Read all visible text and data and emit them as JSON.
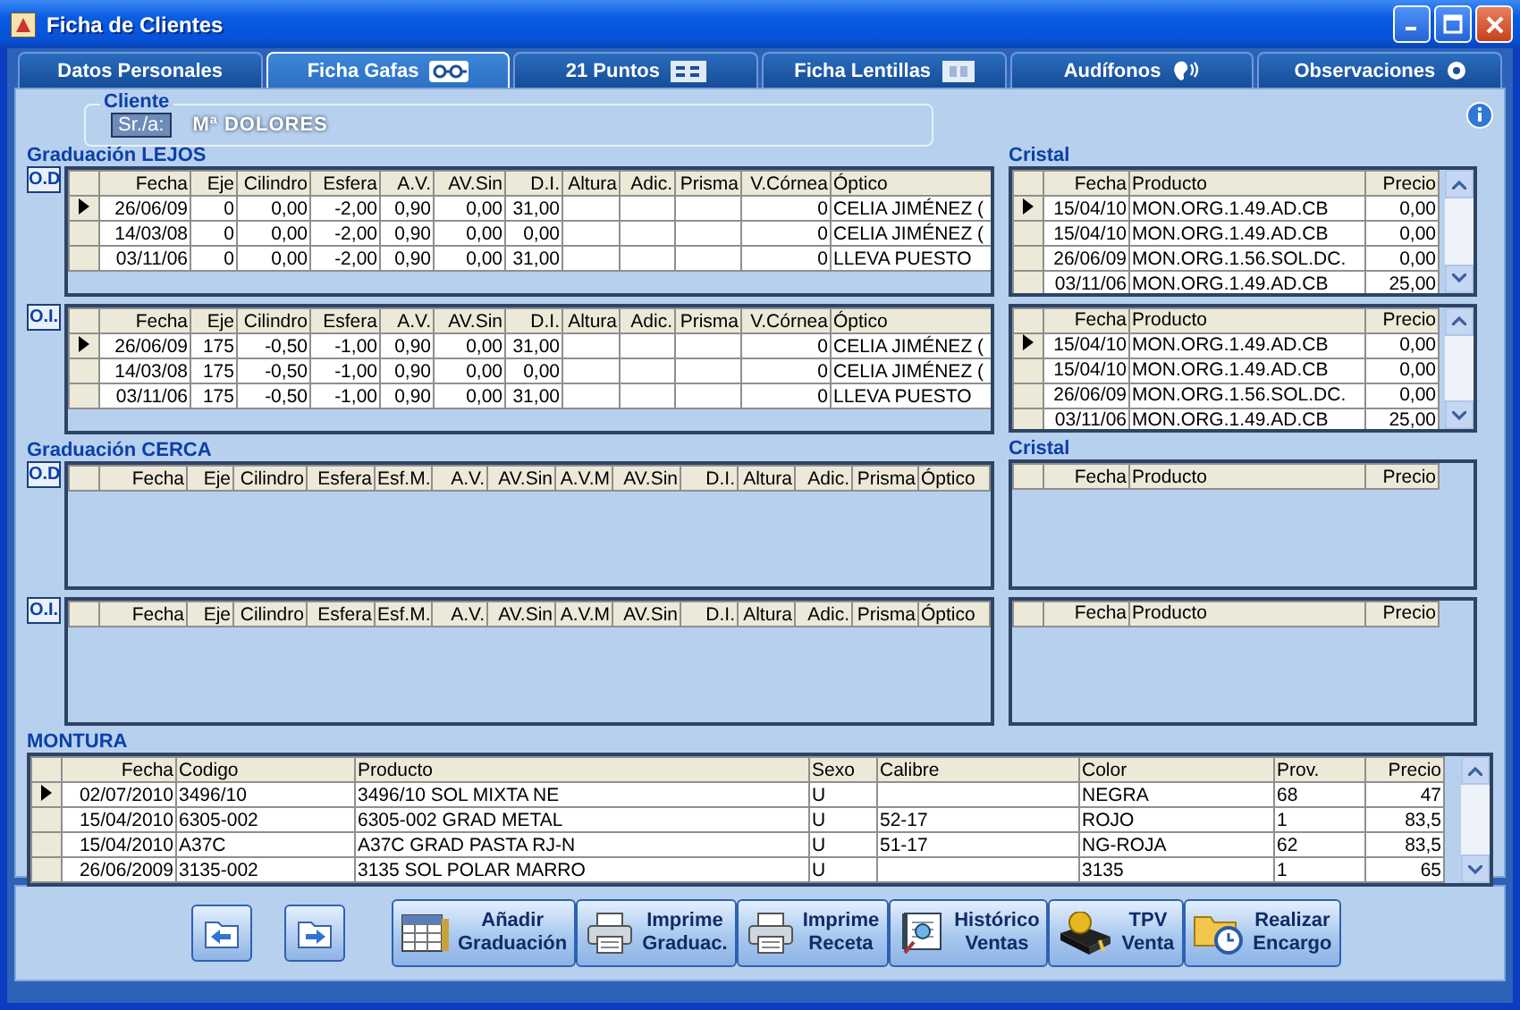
{
  "window": {
    "title": "Ficha de Clientes"
  },
  "tabs": [
    {
      "label": "Datos Personales",
      "selected": false
    },
    {
      "label": "Ficha Gafas",
      "selected": true
    },
    {
      "label": "21 Puntos",
      "selected": false
    },
    {
      "label": "Ficha Lentillas",
      "selected": false
    },
    {
      "label": "Audífonos",
      "selected": false
    },
    {
      "label": "Observaciones",
      "selected": false
    }
  ],
  "cliente": {
    "legend": "Cliente",
    "label": "Sr./a:",
    "value": "Mª DOLORES"
  },
  "lejos": {
    "title": "Graduación LEJOS",
    "od": {
      "label": "O.D",
      "columns": [
        "Fecha",
        "Eje",
        "Cilindro",
        "Esfera",
        "A.V.",
        "AV.Sin",
        "D.I.",
        "Altura",
        "Adic.",
        "Prisma",
        "V.Córnea",
        "Óptico"
      ],
      "rows": [
        {
          "selected": true,
          "cells": [
            "26/06/09",
            "0",
            "0,00",
            "-2,00",
            "0,90",
            "0,00",
            "31,00",
            "",
            "",
            "",
            "0",
            "CELIA JIMÉNEZ ("
          ]
        },
        {
          "selected": false,
          "cells": [
            "14/03/08",
            "0",
            "0,00",
            "-2,00",
            "0,90",
            "0,00",
            "0,00",
            "",
            "",
            "",
            "0",
            "CELIA JIMÉNEZ ("
          ]
        },
        {
          "selected": false,
          "cells": [
            "03/11/06",
            "0",
            "0,00",
            "-2,00",
            "0,90",
            "0,00",
            "31,00",
            "",
            "",
            "",
            "0",
            "LLEVA PUESTO"
          ]
        }
      ]
    },
    "oi": {
      "label": "O.I.",
      "columns": [
        "Fecha",
        "Eje",
        "Cilindro",
        "Esfera",
        "A.V.",
        "AV.Sin",
        "D.I.",
        "Altura",
        "Adic.",
        "Prisma",
        "V.Córnea",
        "Óptico"
      ],
      "rows": [
        {
          "selected": true,
          "cells": [
            "26/06/09",
            "175",
            "-0,50",
            "-1,00",
            "0,90",
            "0,00",
            "31,00",
            "",
            "",
            "",
            "0",
            "CELIA JIMÉNEZ ("
          ]
        },
        {
          "selected": false,
          "cells": [
            "14/03/08",
            "175",
            "-0,50",
            "-1,00",
            "0,90",
            "0,00",
            "0,00",
            "",
            "",
            "",
            "0",
            "CELIA JIMÉNEZ ("
          ]
        },
        {
          "selected": false,
          "cells": [
            "03/11/06",
            "175",
            "-0,50",
            "-1,00",
            "0,90",
            "0,00",
            "31,00",
            "",
            "",
            "",
            "0",
            "LLEVA PUESTO"
          ]
        }
      ]
    }
  },
  "cristal_lejos": {
    "title": "Cristal",
    "od": {
      "columns": [
        "Fecha",
        "Producto",
        "Precio"
      ],
      "rows": [
        {
          "selected": true,
          "cells": [
            "15/04/10",
            "MON.ORG.1.49.AD.CB",
            "0,00"
          ]
        },
        {
          "selected": false,
          "cells": [
            "15/04/10",
            "MON.ORG.1.49.AD.CB",
            "0,00"
          ]
        },
        {
          "selected": false,
          "cells": [
            "26/06/09",
            "MON.ORG.1.56.SOL.DC.",
            "0,00"
          ]
        },
        {
          "selected": false,
          "cells": [
            "03/11/06",
            "MON.ORG.1.49.AD.CB",
            "25,00"
          ]
        }
      ]
    },
    "oi": {
      "columns": [
        "Fecha",
        "Producto",
        "Precio"
      ],
      "rows": [
        {
          "selected": true,
          "cells": [
            "15/04/10",
            "MON.ORG.1.49.AD.CB",
            "0,00"
          ]
        },
        {
          "selected": false,
          "cells": [
            "15/04/10",
            "MON.ORG.1.49.AD.CB",
            "0,00"
          ]
        },
        {
          "selected": false,
          "cells": [
            "26/06/09",
            "MON.ORG.1.56.SOL.DC.",
            "0,00"
          ]
        },
        {
          "selected": false,
          "cells": [
            "03/11/06",
            "MON.ORG.1.49.AD.CB",
            "25,00"
          ]
        }
      ]
    }
  },
  "cerca": {
    "title": "Graduación CERCA",
    "od": {
      "label": "O.D",
      "columns": [
        "Fecha",
        "Eje",
        "Cilindro",
        "Esfera",
        "Esf.M.",
        "A.V.",
        "AV.Sin",
        "A.V.M",
        "AV.Sin",
        "D.I.",
        "Altura",
        "Adic.",
        "Prisma",
        "Óptico"
      ]
    },
    "oi": {
      "label": "O.I.",
      "columns": [
        "Fecha",
        "Eje",
        "Cilindro",
        "Esfera",
        "Esf.M.",
        "A.V.",
        "AV.Sin",
        "A.V.M",
        "AV.Sin",
        "D.I.",
        "Altura",
        "Adic.",
        "Prisma",
        "Óptico"
      ]
    }
  },
  "cristal_cerca": {
    "title": "Cristal",
    "od": {
      "columns": [
        "Fecha",
        "Producto",
        "Precio"
      ]
    },
    "oi": {
      "columns": [
        "Fecha",
        "Producto",
        "Precio"
      ]
    }
  },
  "montura": {
    "title": "MONTURA",
    "columns": [
      "Fecha",
      "Codigo",
      "Producto",
      "Sexo",
      "Calibre",
      "Color",
      "Prov.",
      "Precio"
    ],
    "rows": [
      {
        "selected": true,
        "cells": [
          "02/07/2010",
          "3496/10",
          "3496/10 SOL MIXTA NE",
          "U",
          "",
          "NEGRA",
          "68",
          "47"
        ]
      },
      {
        "selected": false,
        "cells": [
          "15/04/2010",
          "6305-002",
          "6305-002 GRAD METAL",
          "U",
          "52-17",
          "ROJO",
          "1",
          "83,5"
        ]
      },
      {
        "selected": false,
        "cells": [
          "15/04/2010",
          "A37C",
          "A37C GRAD PASTA RJ-N",
          "U",
          "51-17",
          "NG-ROJA",
          "62",
          "83,5"
        ]
      },
      {
        "selected": false,
        "cells": [
          "26/06/2009",
          "3135-002",
          "3135 SOL POLAR MARRO",
          "U",
          "",
          "3135",
          "1",
          "65"
        ]
      }
    ]
  },
  "buttons": [
    {
      "label": "Añadir\nGraduación"
    },
    {
      "label": "Imprime\nGraduac."
    },
    {
      "label": "Imprime\nReceta"
    },
    {
      "label": "Histórico\nVentas"
    },
    {
      "label": "TPV\nVenta"
    },
    {
      "label": "Realizar\nEncargo"
    }
  ]
}
